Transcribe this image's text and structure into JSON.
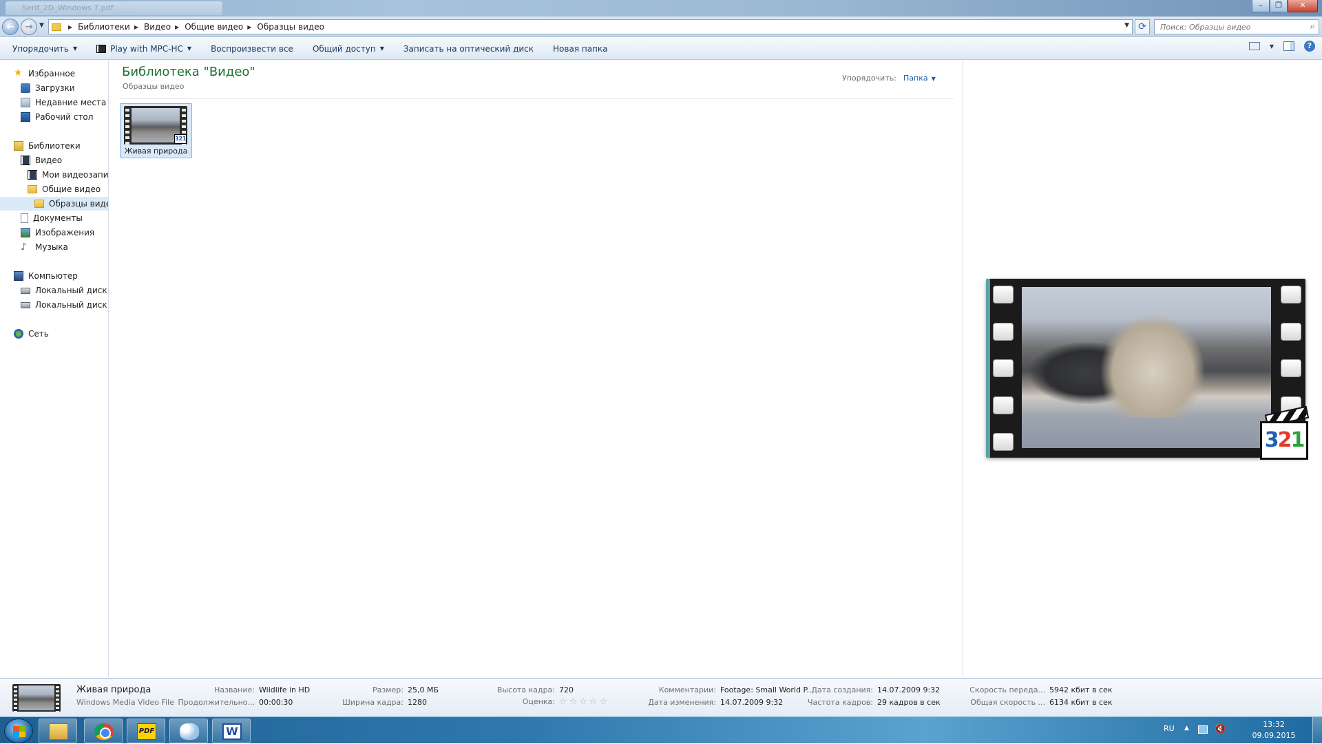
{
  "window": {
    "title_blurred": "Serif_2D_Windows 7.pdf"
  },
  "address": {
    "crumbs": [
      "Библиотеки",
      "Видео",
      "Общие видео",
      "Образцы видео"
    ],
    "search_placeholder": "Поиск: Образцы видео"
  },
  "toolbar": {
    "organize": "Упорядочить",
    "play_with": "Play with MPC-HC",
    "play_all": "Воспроизвести все",
    "share": "Общий доступ",
    "burn": "Записать на оптический диск",
    "new_folder": "Новая папка"
  },
  "nav": {
    "favorites": "Избранное",
    "downloads": "Загрузки",
    "recent": "Недавние места",
    "desktop": "Рабочий стол",
    "libraries": "Библиотеки",
    "video": "Видео",
    "my_videos": "Мои видеозаписи",
    "public_videos": "Общие видео",
    "sample_videos": "Образцы видео",
    "documents": "Документы",
    "pictures": "Изображения",
    "music": "Музыка",
    "computer": "Компьютер",
    "disk_c": "Локальный диск (C",
    "disk_d": "Локальный диск (D",
    "network": "Сеть"
  },
  "content": {
    "title": "Библиотека \"Видео\"",
    "subtitle": "Образцы видео",
    "arrange_label": "Упорядочить:",
    "arrange_value": "Папка",
    "file_name": "Живая природа"
  },
  "details": {
    "name": "Живая природа",
    "type": "Windows Media Video File",
    "props": {
      "title_k": "Название:",
      "title_v": "Wildlife in HD",
      "duration_k": "Продолжительно...",
      "duration_v": "00:00:30",
      "size_k": "Размер:",
      "size_v": "25,0 МБ",
      "width_k": "Ширина кадра:",
      "width_v": "1280",
      "height_k": "Высота кадра:",
      "height_v": "720",
      "rating_k": "Оценка:",
      "rating_v": "☆☆☆☆☆",
      "comments_k": "Комментарии:",
      "comments_v": "Footage: Small World P...",
      "modified_k": "Дата изменения:",
      "modified_v": "14.07.2009 9:32",
      "created_k": "Дата создания:",
      "created_v": "14.07.2009 9:32",
      "framerate_k": "Частота кадров:",
      "framerate_v": "29 кадров в сек",
      "bitrate_k": "Скорость переда...",
      "bitrate_v": "5942 кбит в сек",
      "total_k": "Общая скорость ...",
      "total_v": "6134 кбит в сек"
    }
  },
  "taskbar": {
    "lang": "RU",
    "time": "13:32",
    "date": "09.09.2015",
    "pdf_label": "PDF",
    "word_label": "W"
  },
  "preview_badge": {
    "d1": "3",
    "d2": "2",
    "d3": "1"
  }
}
